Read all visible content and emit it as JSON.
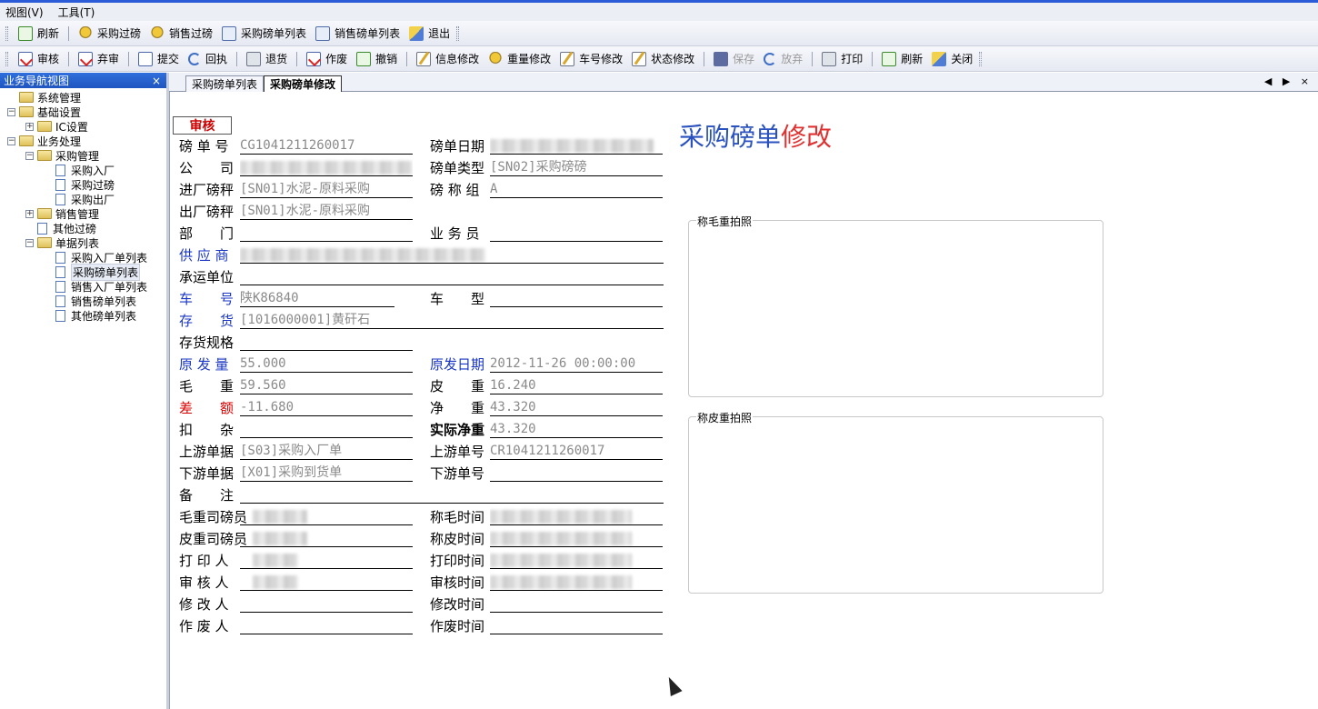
{
  "menu": [
    "视图(V)",
    "工具(T)"
  ],
  "toolbar1": [
    {
      "label": "刷新",
      "icon": "refresh-icon"
    },
    {
      "label": "采购过磅",
      "icon": "scale-icon"
    },
    {
      "label": "销售过磅",
      "icon": "scale-icon"
    },
    {
      "label": "采购磅单列表",
      "icon": "list-search-icon"
    },
    {
      "label": "销售磅单列表",
      "icon": "list-search-icon"
    },
    {
      "label": "退出",
      "icon": "exit-icon"
    }
  ],
  "toolbar2": [
    {
      "label": "审核",
      "icon": "approve-icon",
      "enabled": true
    },
    {
      "label": "弃审",
      "icon": "unapprove-icon",
      "enabled": true
    },
    {
      "label": "提交",
      "icon": "submit-icon",
      "enabled": true
    },
    {
      "label": "回执",
      "icon": "undo-icon",
      "enabled": true
    },
    {
      "label": "退货",
      "icon": "return-icon",
      "enabled": true
    },
    {
      "label": "作废",
      "icon": "void-icon",
      "enabled": true
    },
    {
      "label": "撤销",
      "icon": "cancel-icon",
      "enabled": true
    },
    {
      "label": "信息修改",
      "icon": "edit-icon",
      "enabled": true
    },
    {
      "label": "重量修改",
      "icon": "scale-icon",
      "enabled": true
    },
    {
      "label": "车号修改",
      "icon": "edit-icon",
      "enabled": true
    },
    {
      "label": "状态修改",
      "icon": "edit-icon",
      "enabled": true
    },
    {
      "label": "保存",
      "icon": "save-icon",
      "enabled": false
    },
    {
      "label": "放弃",
      "icon": "undo-icon",
      "enabled": false
    },
    {
      "label": "打印",
      "icon": "print-icon",
      "enabled": true
    },
    {
      "label": "刷新",
      "icon": "refresh-icon",
      "enabled": true
    },
    {
      "label": "关闭",
      "icon": "exit-icon",
      "enabled": true
    }
  ],
  "nav": {
    "title": "业务导航视图",
    "close": "×",
    "tree": [
      {
        "label": "系统管理",
        "level": 0,
        "type": "folder-open",
        "expander": ""
      },
      {
        "label": "基础设置",
        "level": 0,
        "type": "folder-open",
        "expander": "−"
      },
      {
        "label": "IC设置",
        "level": 1,
        "type": "folder",
        "expander": "+"
      },
      {
        "label": "业务处理",
        "level": 0,
        "type": "folder-open",
        "expander": "−"
      },
      {
        "label": "采购管理",
        "level": 1,
        "type": "folder-open",
        "expander": "−"
      },
      {
        "label": "采购入厂",
        "level": 2,
        "type": "page",
        "expander": ""
      },
      {
        "label": "采购过磅",
        "level": 2,
        "type": "page",
        "expander": ""
      },
      {
        "label": "采购出厂",
        "level": 2,
        "type": "page",
        "expander": ""
      },
      {
        "label": "销售管理",
        "level": 1,
        "type": "folder",
        "expander": "+"
      },
      {
        "label": "其他过磅",
        "level": 1,
        "type": "page",
        "expander": ""
      },
      {
        "label": "单据列表",
        "level": 1,
        "type": "folder-open",
        "expander": "−"
      },
      {
        "label": "采购入厂单列表",
        "level": 2,
        "type": "page",
        "expander": ""
      },
      {
        "label": "采购磅单列表",
        "level": 2,
        "type": "page",
        "expander": "",
        "selected": true
      },
      {
        "label": "销售入厂单列表",
        "level": 2,
        "type": "page",
        "expander": ""
      },
      {
        "label": "销售磅单列表",
        "level": 2,
        "type": "page",
        "expander": ""
      },
      {
        "label": "其他磅单列表",
        "level": 2,
        "type": "page",
        "expander": ""
      }
    ]
  },
  "tabs": [
    "采购磅单列表",
    "采购磅单修改"
  ],
  "tabnav": "◀ ▶ ×",
  "form": {
    "status": "审核",
    "title_part1": "采购磅单",
    "title_part2": "修改",
    "fields": {
      "bill_no": {
        "label": "磅 单 号",
        "value": "CG1041211260017"
      },
      "bill_date": {
        "label": "磅单日期",
        "value": ""
      },
      "company": {
        "label": "公　　司",
        "value": ""
      },
      "bill_type": {
        "label": "磅单类型",
        "value": "[SN02]采购磅磅"
      },
      "in_scale": {
        "label": "进厂磅秤",
        "value": "[SN01]水泥-原料采购"
      },
      "scale_group": {
        "label": "磅 称 组",
        "value": "A"
      },
      "out_scale": {
        "label": "出厂磅秤",
        "value": "[SN01]水泥-原料采购"
      },
      "dept": {
        "label": "部　　门",
        "value": ""
      },
      "salesman": {
        "label": "业 务 员",
        "value": ""
      },
      "supplier": {
        "label": "供 应 商",
        "value": ""
      },
      "carrier": {
        "label": "承运单位",
        "value": ""
      },
      "car_no": {
        "label": "车　　号",
        "value": "陕K86840"
      },
      "car_type": {
        "label": "车　　型",
        "value": ""
      },
      "inventory": {
        "label": "存　　货",
        "value": "[1016000001]黄矸石"
      },
      "spec": {
        "label": "存货规格",
        "value": ""
      },
      "orig_qty": {
        "label": "原 发 量",
        "value": "55.000"
      },
      "orig_date": {
        "label": "原发日期",
        "value": "2012-11-26 00:00:00"
      },
      "gross": {
        "label": "毛　　重",
        "value": "59.560"
      },
      "tare": {
        "label": "皮　　重",
        "value": "16.240"
      },
      "diff": {
        "label": "差　　额",
        "value": "-11.680"
      },
      "net": {
        "label": "净　　重",
        "value": "43.320"
      },
      "deduct": {
        "label": "扣　　杂",
        "value": ""
      },
      "actual_net": {
        "label": "实际净重",
        "value": "43.320"
      },
      "up_doc": {
        "label": "上游单据",
        "value": "[S03]采购入厂单"
      },
      "up_no": {
        "label": "上游单号",
        "value": "CR1041211260017"
      },
      "down_doc": {
        "label": "下游单据",
        "value": "[X01]采购到货单"
      },
      "down_no": {
        "label": "下游单号",
        "value": ""
      },
      "remark": {
        "label": "备　　注",
        "value": ""
      },
      "gross_op": {
        "label": "毛重司磅员",
        "value": ""
      },
      "gross_time": {
        "label": "称毛时间",
        "value": ""
      },
      "tare_op": {
        "label": "皮重司磅员",
        "value": ""
      },
      "tare_time": {
        "label": "称皮时间",
        "value": ""
      },
      "printer": {
        "label": "打 印 人",
        "value": ""
      },
      "print_time": {
        "label": "打印时间",
        "value": ""
      },
      "auditor": {
        "label": "审 核 人",
        "value": ""
      },
      "audit_time": {
        "label": "审核时间",
        "value": ""
      },
      "modifier": {
        "label": "修 改 人",
        "value": ""
      },
      "modify_time": {
        "label": "修改时间",
        "value": ""
      },
      "voider": {
        "label": "作 废 人",
        "value": ""
      },
      "void_time": {
        "label": "作废时间",
        "value": ""
      }
    },
    "photo_gross": "称毛重拍照",
    "photo_tare": "称皮重拍照"
  },
  "colors": {
    "accent": "#1f55c0",
    "label_blue": "#1a36c4",
    "label_red": "#d00000",
    "status_red": "#cc0000"
  }
}
